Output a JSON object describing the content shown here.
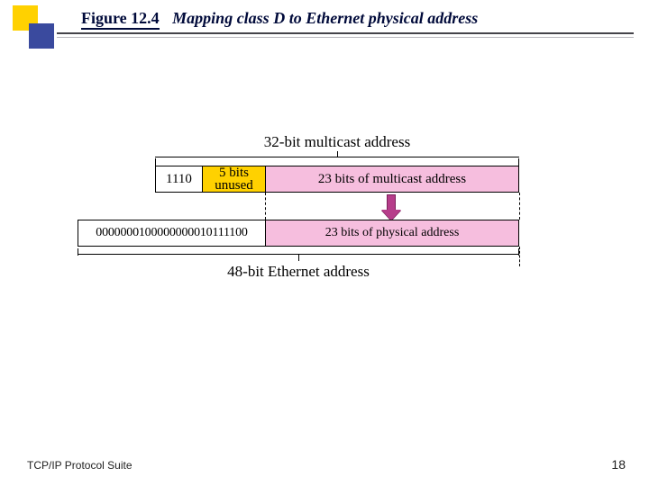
{
  "title": {
    "figure": "Figure 12.4",
    "caption": "Mapping class D to Ethernet physical address"
  },
  "diagram": {
    "topLabel": "32-bit multicast address",
    "row32": {
      "prefix": "1110",
      "unused": "5 bits\nunused",
      "multicast": "23 bits of multicast address"
    },
    "row48": {
      "oui_bits": "0000000100000000010111100",
      "physical": "23 bits of physical address"
    },
    "bottomLabel": "48-bit Ethernet address"
  },
  "footer": {
    "left": "TCP/IP Protocol Suite",
    "page": "18"
  }
}
